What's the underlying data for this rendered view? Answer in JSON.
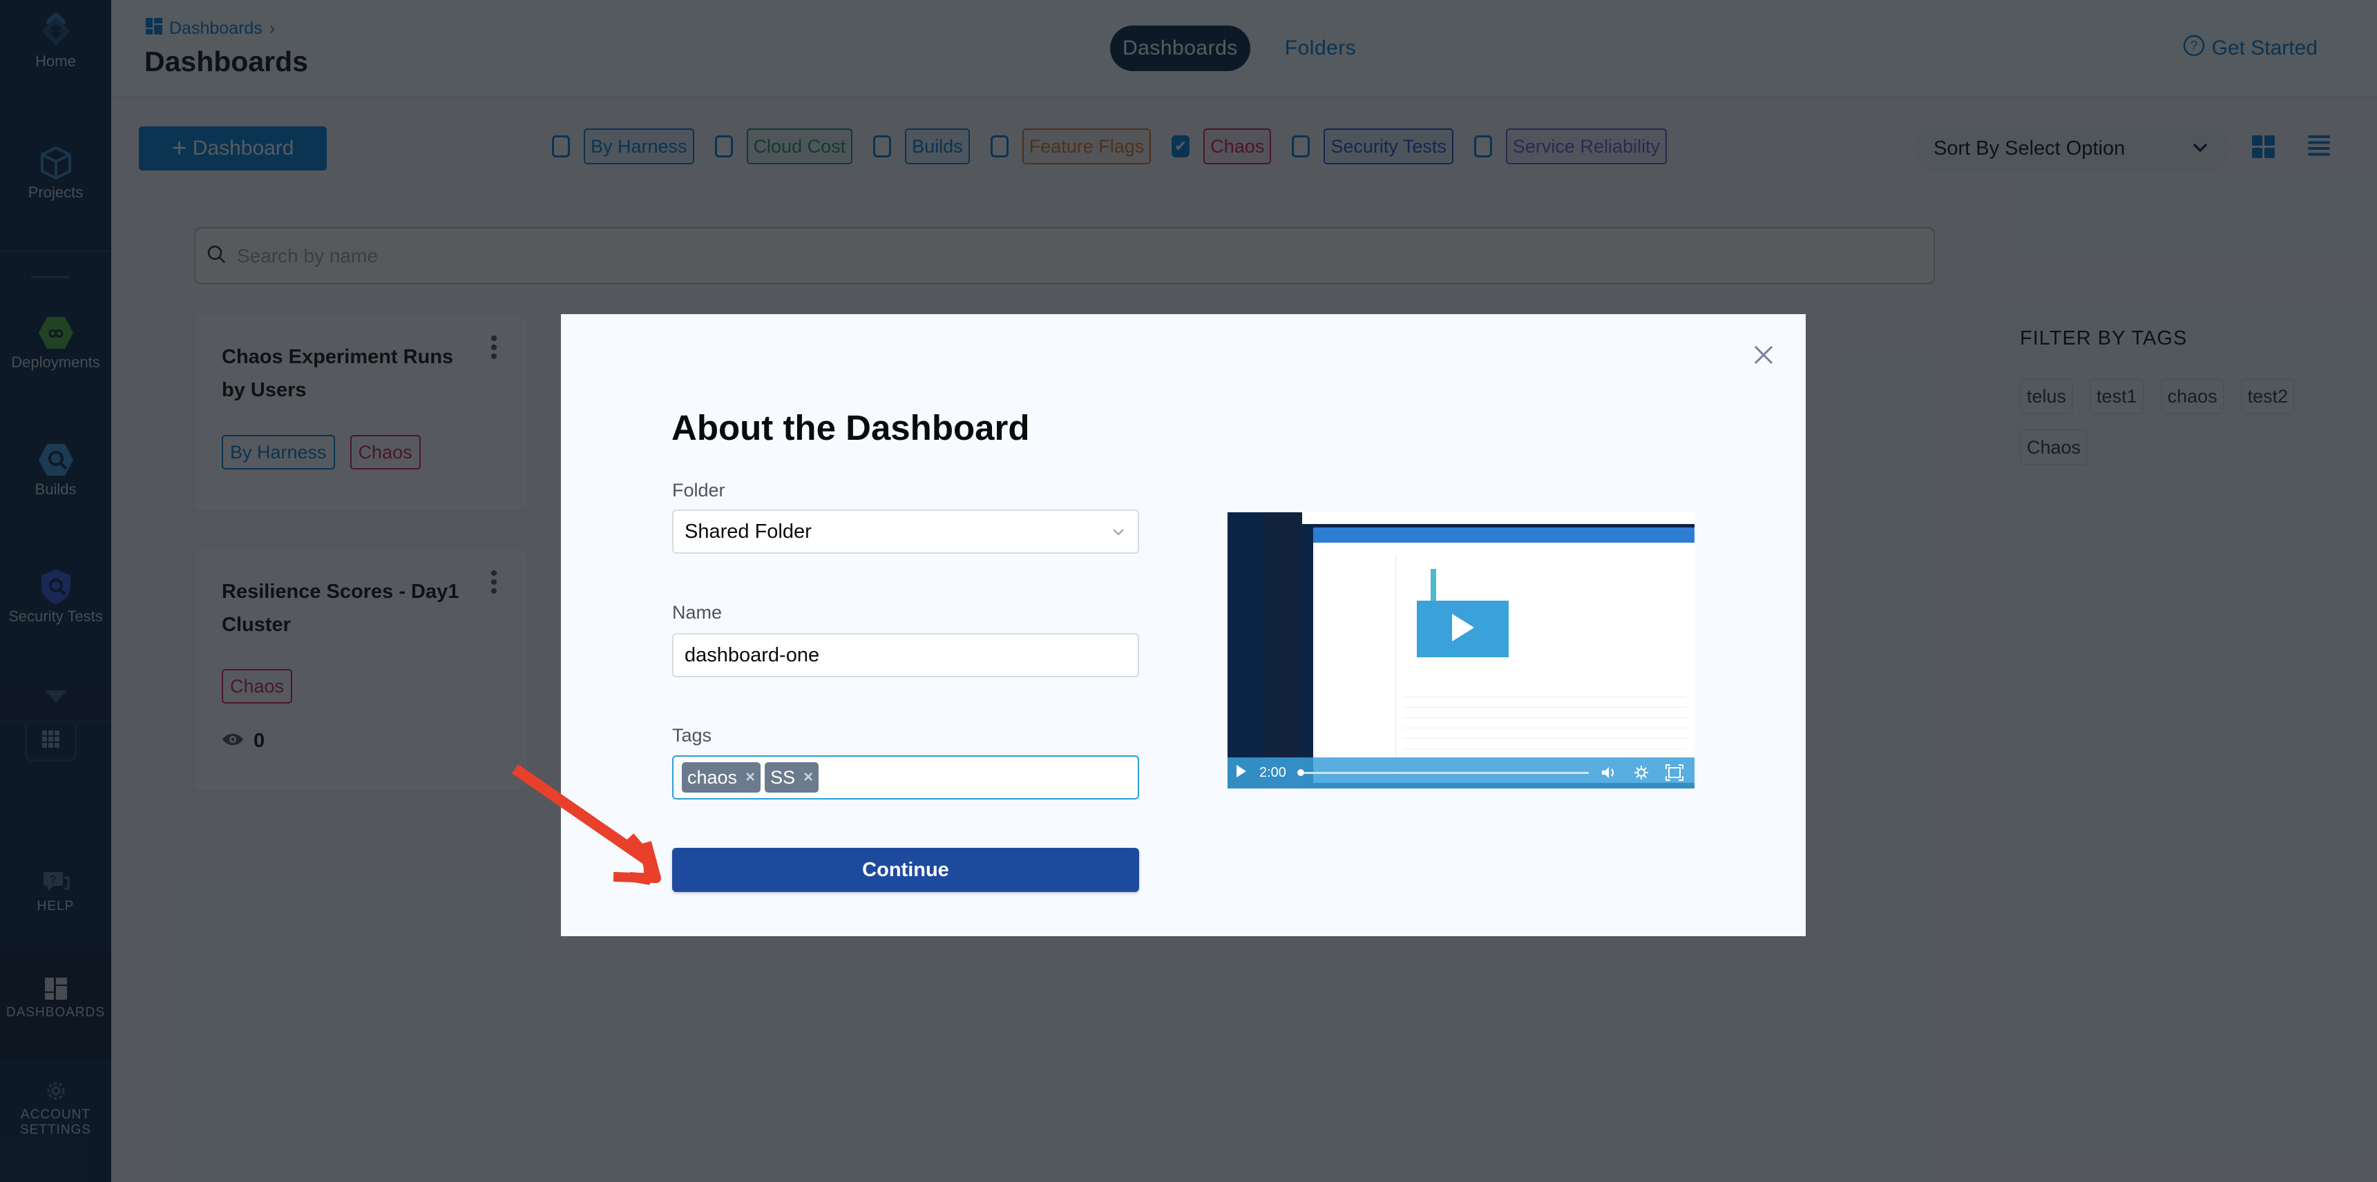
{
  "sidebar": {
    "items": [
      {
        "label": "Home",
        "icon": "harness-logo-icon"
      },
      {
        "label": "Projects",
        "icon": "cube-icon"
      },
      {
        "label": "Deployments",
        "icon": "deployments-icon"
      },
      {
        "label": "Builds",
        "icon": "builds-icon"
      },
      {
        "label": "Security Tests",
        "icon": "shield-icon"
      }
    ],
    "bottom": [
      {
        "label": "HELP",
        "icon": "help-chat-icon"
      },
      {
        "label": "DASHBOARDS",
        "icon": "dashboard-icon"
      },
      {
        "label": "ACCOUNT SETTINGS",
        "icon": "gear-icon"
      }
    ]
  },
  "header": {
    "breadcrumb": "Dashboards",
    "title": "Dashboards",
    "tabs": [
      {
        "label": "Dashboards",
        "active": true
      },
      {
        "label": "Folders",
        "active": false
      }
    ],
    "get_started": "Get Started"
  },
  "toolbar": {
    "add_dashboard": "Dashboard",
    "filters": [
      {
        "label": "By Harness",
        "checked": false,
        "color": "#0278d5"
      },
      {
        "label": "Cloud Cost",
        "checked": false,
        "color": "#1b8f5e"
      },
      {
        "label": "Builds",
        "checked": false,
        "color": "#0278d5"
      },
      {
        "label": "Feature Flags",
        "checked": false,
        "color": "#e07318"
      },
      {
        "label": "Chaos",
        "checked": true,
        "color": "#d4184f"
      },
      {
        "label": "Security Tests",
        "checked": false,
        "color": "#1f4fd1"
      },
      {
        "label": "Service Reliability",
        "checked": false,
        "color": "#7a4fd6"
      }
    ],
    "sort_label": "Sort By Select Option"
  },
  "search": {
    "placeholder": "Search by name"
  },
  "cards": [
    {
      "title": "Chaos Experiment Runs by Users",
      "tags": [
        {
          "label": "By Harness",
          "color": "#0278d5"
        },
        {
          "label": "Chaos",
          "color": "#d4184f"
        }
      ]
    },
    {
      "title": "Resilience Scores - Day1 Cluster",
      "tags": [
        {
          "label": "Chaos",
          "color": "#d4184f"
        }
      ],
      "views": "0"
    }
  ],
  "tag_panel": {
    "title": "FILTER BY TAGS",
    "tags": [
      "telus",
      "test1",
      "chaos",
      "test2",
      "Chaos"
    ]
  },
  "modal": {
    "title": "About the Dashboard",
    "folder_label": "Folder",
    "folder_value": "Shared Folder",
    "name_label": "Name",
    "name_value": "dashboard-one",
    "tags_label": "Tags",
    "tags": [
      "chaos",
      "SS"
    ],
    "continue_label": "Continue",
    "video": {
      "duration": "2:00",
      "progress": 0
    }
  },
  "colors": {
    "brand_blue": "#0278d5",
    "sidebar": "#0a2446",
    "continue": "#1e4a9e",
    "annotation_arrow": "#e8402a"
  }
}
